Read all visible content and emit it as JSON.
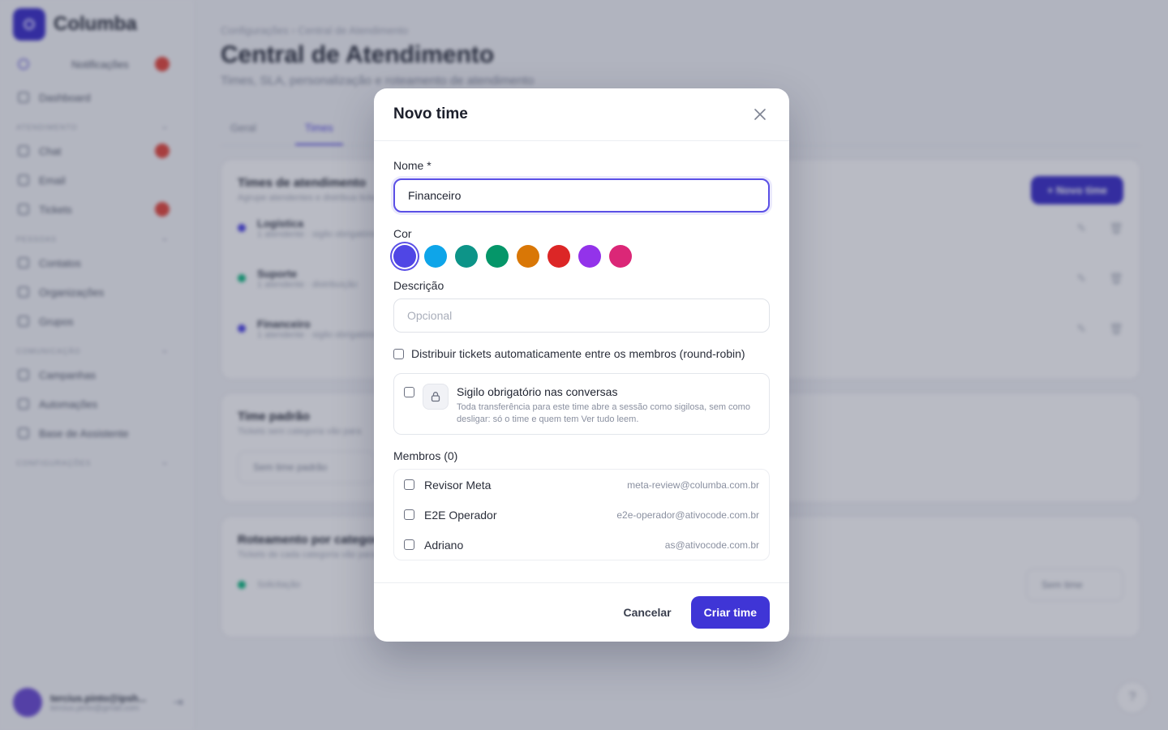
{
  "background": {
    "brand": "Columba",
    "sidebar": {
      "notifications": "Notificações",
      "dashboard": "Dashboard",
      "section_atendimento": "ATENDIMENTO",
      "chat": "Chat",
      "email": "Email",
      "tickets": "Tickets",
      "section_pessoas": "PESSOAS",
      "contatos": "Contatos",
      "organizacoes": "Organizações",
      "grupos": "Grupos",
      "section_comunicacao": "COMUNICAÇÃO",
      "campanhas": "Campanhas",
      "automacoes": "Automações",
      "base": "Base de Assistente",
      "section_config": "CONFIGURAÇÕES",
      "user_name": "tercius.pinto@ipsh...",
      "user_mail": "tercius.pinto@gmail.com"
    },
    "breadcrumb": {
      "parent": "Configurações",
      "sep": "›",
      "current": "Central de Atendimento"
    },
    "page_title": "Central de Atendimento",
    "page_subtitle": "Times, SLA, personalização e roteamento de atendimento",
    "tabs": {
      "geral": "Geral",
      "times": "Times"
    },
    "teams_card": {
      "title": "Times de atendimento",
      "subtitle": "Agrupe atendentes e distribua tickets",
      "new_button": "+ Novo time",
      "rows": [
        {
          "name": "Logística",
          "meta": "1 atendente · sigilo obrigatório",
          "color": "#4f46e5"
        },
        {
          "name": "Suporte",
          "meta": "1 atendente · distribuição",
          "color": "#10b981"
        },
        {
          "name": "Financeiro",
          "meta": "1 atendente · sigilo obrigatório",
          "color": "#4f46e5"
        }
      ]
    },
    "default_card": {
      "title": "Time padrão",
      "subtitle": "Tickets sem categoria vão para",
      "select": "Sem time padrão"
    },
    "routing_card": {
      "title": "Roteamento por categoria",
      "subtitle": "Tickets de cada categoria vão para",
      "row_label": "Solicitação",
      "row_select": "Sem time"
    }
  },
  "modal": {
    "title": "Novo time",
    "name_label": "Nome *",
    "name_value": "Financeiro",
    "color_label": "Cor",
    "colors": [
      "#4f46e5",
      "#0ea5e9",
      "#0d9488",
      "#059669",
      "#d97706",
      "#dc2626",
      "#9333ea",
      "#db2777"
    ],
    "description_label": "Descrição",
    "description_placeholder": "Opcional",
    "roundrobin_label": "Distribuir tickets automaticamente entre os membros (round-robin)",
    "secret_title": "Sigilo obrigatório nas conversas",
    "secret_desc": "Toda transferência para este time abre a sessão como sigilosa, sem como desligar: só o time e quem tem Ver tudo leem.",
    "members_label": "Membros (0)",
    "members": [
      {
        "name": "Revisor Meta",
        "email": "meta-review@columba.com.br"
      },
      {
        "name": "E2E Operador",
        "email": "e2e-operador@ativocode.com.br"
      },
      {
        "name": "Adriano",
        "email": "as@ativocode.com.br"
      }
    ],
    "cancel_label": "Cancelar",
    "create_label": "Criar time"
  }
}
